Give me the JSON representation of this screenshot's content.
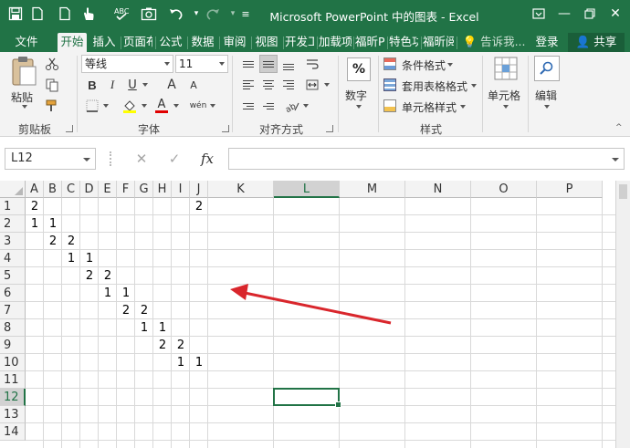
{
  "title_bar": {
    "title": "Microsoft PowerPoint 中的图表 - Excel",
    "quick_access_icons": [
      "save-icon",
      "file-icon",
      "touch-mode-icon",
      "spellcheck-icon",
      "camera-icon",
      "undo-icon",
      "redo-icon",
      "customize-icon"
    ],
    "window_controls": [
      "ribbon-display-icon",
      "minimize-icon",
      "restore-icon",
      "close-icon"
    ]
  },
  "tabs": {
    "file": "文件",
    "home": "开始",
    "insert": "插入",
    "layout": "页面布局",
    "formulas": "公式",
    "data": "数据",
    "review": "审阅",
    "view": "视图",
    "developer": "开发工具",
    "addins": "加载项",
    "foxit_pdf": "福昕PDF",
    "special": "特色功能",
    "foxit_reader": "福昕阅读器",
    "tell_me": "告诉我...",
    "login": "登录",
    "share": "共享"
  },
  "ribbon": {
    "clipboard": {
      "paste": "粘贴",
      "group": "剪贴板"
    },
    "font": {
      "name": "等线",
      "size": "11",
      "bold": "B",
      "italic": "I",
      "underline": "U",
      "grow": "A",
      "shrink": "A",
      "font_color": "A",
      "phonetic": "wén",
      "group": "字体"
    },
    "alignment": {
      "group": "对齐方式"
    },
    "number": {
      "symbol": "%",
      "label": "数字"
    },
    "styles": {
      "conditional": "条件格式",
      "table": "套用表格格式",
      "cell_styles": "单元格样式",
      "group": "样式"
    },
    "cells": {
      "label": "单元格"
    },
    "editing": {
      "label": "编辑"
    }
  },
  "formula_bar": {
    "name_box": "L12",
    "cancel": "✕",
    "enter": "✓",
    "fx": "fx",
    "content": ""
  },
  "sheet": {
    "columns": [
      "A",
      "B",
      "C",
      "D",
      "E",
      "F",
      "G",
      "H",
      "I",
      "J",
      "K",
      "L",
      "M",
      "N",
      "O",
      "P"
    ],
    "rows": [
      "1",
      "2",
      "3",
      "4",
      "5",
      "6",
      "7",
      "8",
      "9",
      "10",
      "11",
      "12",
      "13",
      "14"
    ],
    "selected_cell": "L12",
    "cells": [
      {
        "ref": "A1",
        "value": "2"
      },
      {
        "ref": "J1",
        "value": "2"
      },
      {
        "ref": "A2",
        "value": "1"
      },
      {
        "ref": "B2",
        "value": "1"
      },
      {
        "ref": "B3",
        "value": "2"
      },
      {
        "ref": "C3",
        "value": "2"
      },
      {
        "ref": "C4",
        "value": "1"
      },
      {
        "ref": "D4",
        "value": "1"
      },
      {
        "ref": "D5",
        "value": "2"
      },
      {
        "ref": "E5",
        "value": "2"
      },
      {
        "ref": "E6",
        "value": "1"
      },
      {
        "ref": "F6",
        "value": "1"
      },
      {
        "ref": "F7",
        "value": "2"
      },
      {
        "ref": "G7",
        "value": "2"
      },
      {
        "ref": "G8",
        "value": "1"
      },
      {
        "ref": "H8",
        "value": "1"
      },
      {
        "ref": "H9",
        "value": "2"
      },
      {
        "ref": "I9",
        "value": "2"
      },
      {
        "ref": "I10",
        "value": "1"
      },
      {
        "ref": "J10",
        "value": "1"
      }
    ]
  },
  "annotation": {
    "arrow_color": "#d9262c"
  },
  "colors": {
    "excel_green": "#217346",
    "ribbon_bg": "#f3f3f3",
    "grid_line": "#d9d9d9"
  }
}
